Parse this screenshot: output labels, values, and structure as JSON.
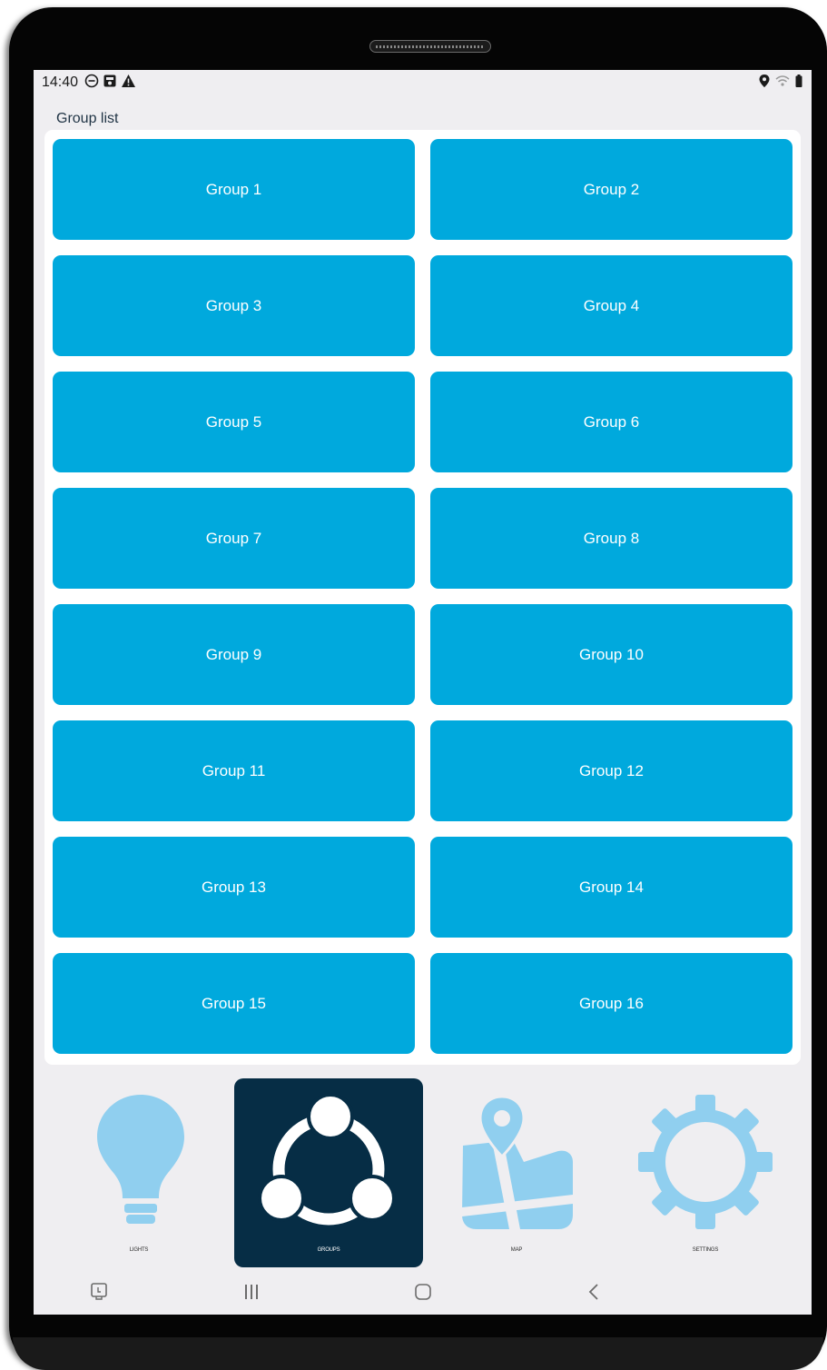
{
  "status_bar": {
    "time": "14:40",
    "left_icons": [
      "dnd-icon",
      "screenshot-icon",
      "warning-icon"
    ],
    "right_icons": [
      "location-icon",
      "wifi-icon",
      "battery-icon"
    ]
  },
  "page": {
    "title": "Group list"
  },
  "groups": [
    "Group 1",
    "Group 2",
    "Group 3",
    "Group 4",
    "Group 5",
    "Group 6",
    "Group 7",
    "Group 8",
    "Group 9",
    "Group 10",
    "Group 11",
    "Group 12",
    "Group 13",
    "Group 14",
    "Group 15",
    "Group 16"
  ],
  "bottom_nav": {
    "items": [
      {
        "label": "LIGHTS",
        "icon": "lightbulb-icon",
        "active": false
      },
      {
        "label": "GROUPS",
        "icon": "groups-icon",
        "active": true
      },
      {
        "label": "MAP",
        "icon": "map-icon",
        "active": false
      },
      {
        "label": "SETTINGS",
        "icon": "gear-icon",
        "active": false
      }
    ]
  },
  "system_nav": {
    "buttons": [
      "recent-screenshot-icon",
      "recents-icon",
      "home-icon",
      "back-icon"
    ]
  },
  "colors": {
    "accent": "#00a9dd",
    "nav_active_bg": "#062d45",
    "nav_icon": "#90cfef",
    "screen_bg": "#efeef1"
  }
}
